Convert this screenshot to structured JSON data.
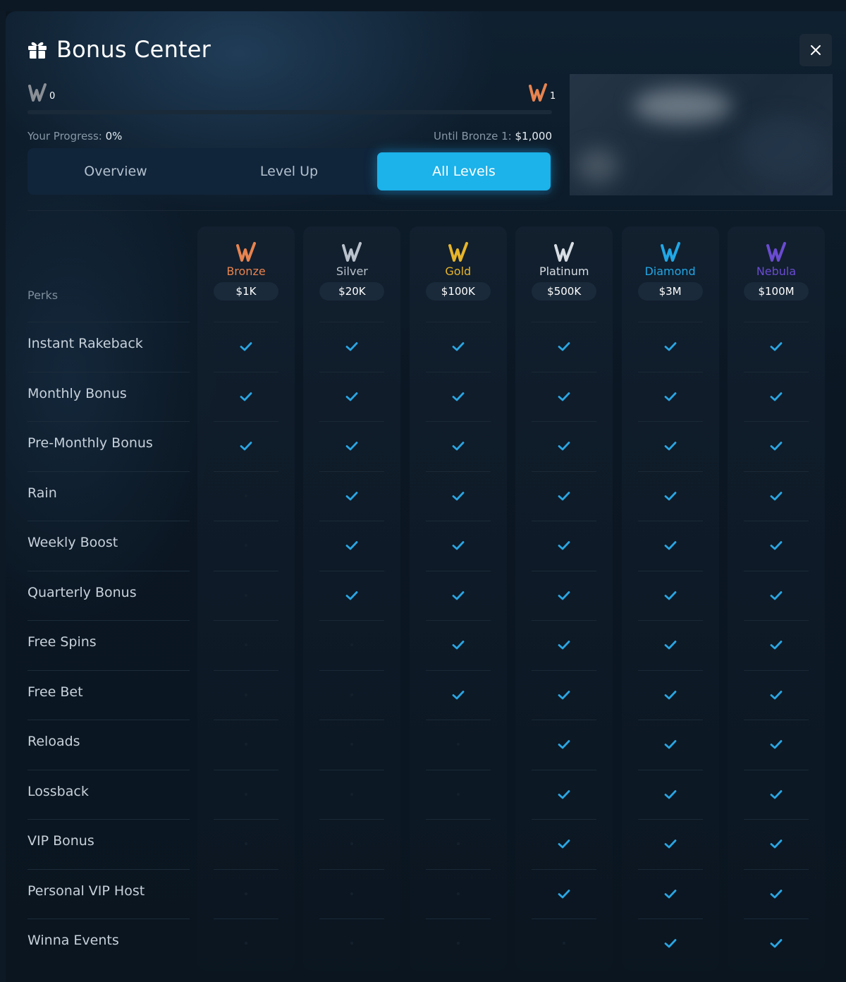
{
  "modal": {
    "title": "Bonus Center",
    "close_label": "Close"
  },
  "progress": {
    "current_level": "0",
    "next_level": "1",
    "label": "Your Progress:",
    "value": "0%",
    "percent": 0,
    "until_label": "Until Bronze 1:",
    "until_value": "$1,000"
  },
  "tabs": [
    {
      "label": "Overview",
      "active": false
    },
    {
      "label": "Level Up",
      "active": false
    },
    {
      "label": "All Levels",
      "active": true
    }
  ],
  "table": {
    "perks_header": "Perks",
    "levels": [
      {
        "name": "Bronze",
        "threshold": "$1K",
        "color": "#e8834f"
      },
      {
        "name": "Silver",
        "threshold": "$20K",
        "color": "#b9c2cc"
      },
      {
        "name": "Gold",
        "threshold": "$100K",
        "color": "#e7b52a"
      },
      {
        "name": "Platinum",
        "threshold": "$500K",
        "color": "#d7dde3"
      },
      {
        "name": "Diamond",
        "threshold": "$3M",
        "color": "#21a7e6"
      },
      {
        "name": "Nebula",
        "threshold": "$100M",
        "color": "#6a4bd1"
      }
    ],
    "perks": [
      {
        "name": "Instant Rakeback",
        "available": [
          true,
          true,
          true,
          true,
          true,
          true
        ]
      },
      {
        "name": "Monthly Bonus",
        "available": [
          true,
          true,
          true,
          true,
          true,
          true
        ]
      },
      {
        "name": "Pre-Monthly Bonus",
        "available": [
          true,
          true,
          true,
          true,
          true,
          true
        ]
      },
      {
        "name": "Rain",
        "available": [
          false,
          true,
          true,
          true,
          true,
          true
        ]
      },
      {
        "name": "Weekly Boost",
        "available": [
          false,
          true,
          true,
          true,
          true,
          true
        ]
      },
      {
        "name": "Quarterly Bonus",
        "available": [
          false,
          true,
          true,
          true,
          true,
          true
        ]
      },
      {
        "name": "Free Spins",
        "available": [
          false,
          false,
          true,
          true,
          true,
          true
        ]
      },
      {
        "name": "Free Bet",
        "available": [
          false,
          false,
          true,
          true,
          true,
          true
        ]
      },
      {
        "name": "Reloads",
        "available": [
          false,
          false,
          false,
          true,
          true,
          true
        ]
      },
      {
        "name": "Lossback",
        "available": [
          false,
          false,
          false,
          true,
          true,
          true
        ]
      },
      {
        "name": "VIP Bonus",
        "available": [
          false,
          false,
          false,
          true,
          true,
          true
        ]
      },
      {
        "name": "Personal VIP Host",
        "available": [
          false,
          false,
          false,
          true,
          true,
          true
        ]
      },
      {
        "name": "Winna Events",
        "available": [
          false,
          false,
          false,
          false,
          true,
          true
        ]
      }
    ]
  },
  "colors": {
    "accent": "#1cb2ea",
    "check": "#2aa6e3",
    "current_level_badge": "#8a8f96",
    "next_level_badge": "#e8834f"
  }
}
